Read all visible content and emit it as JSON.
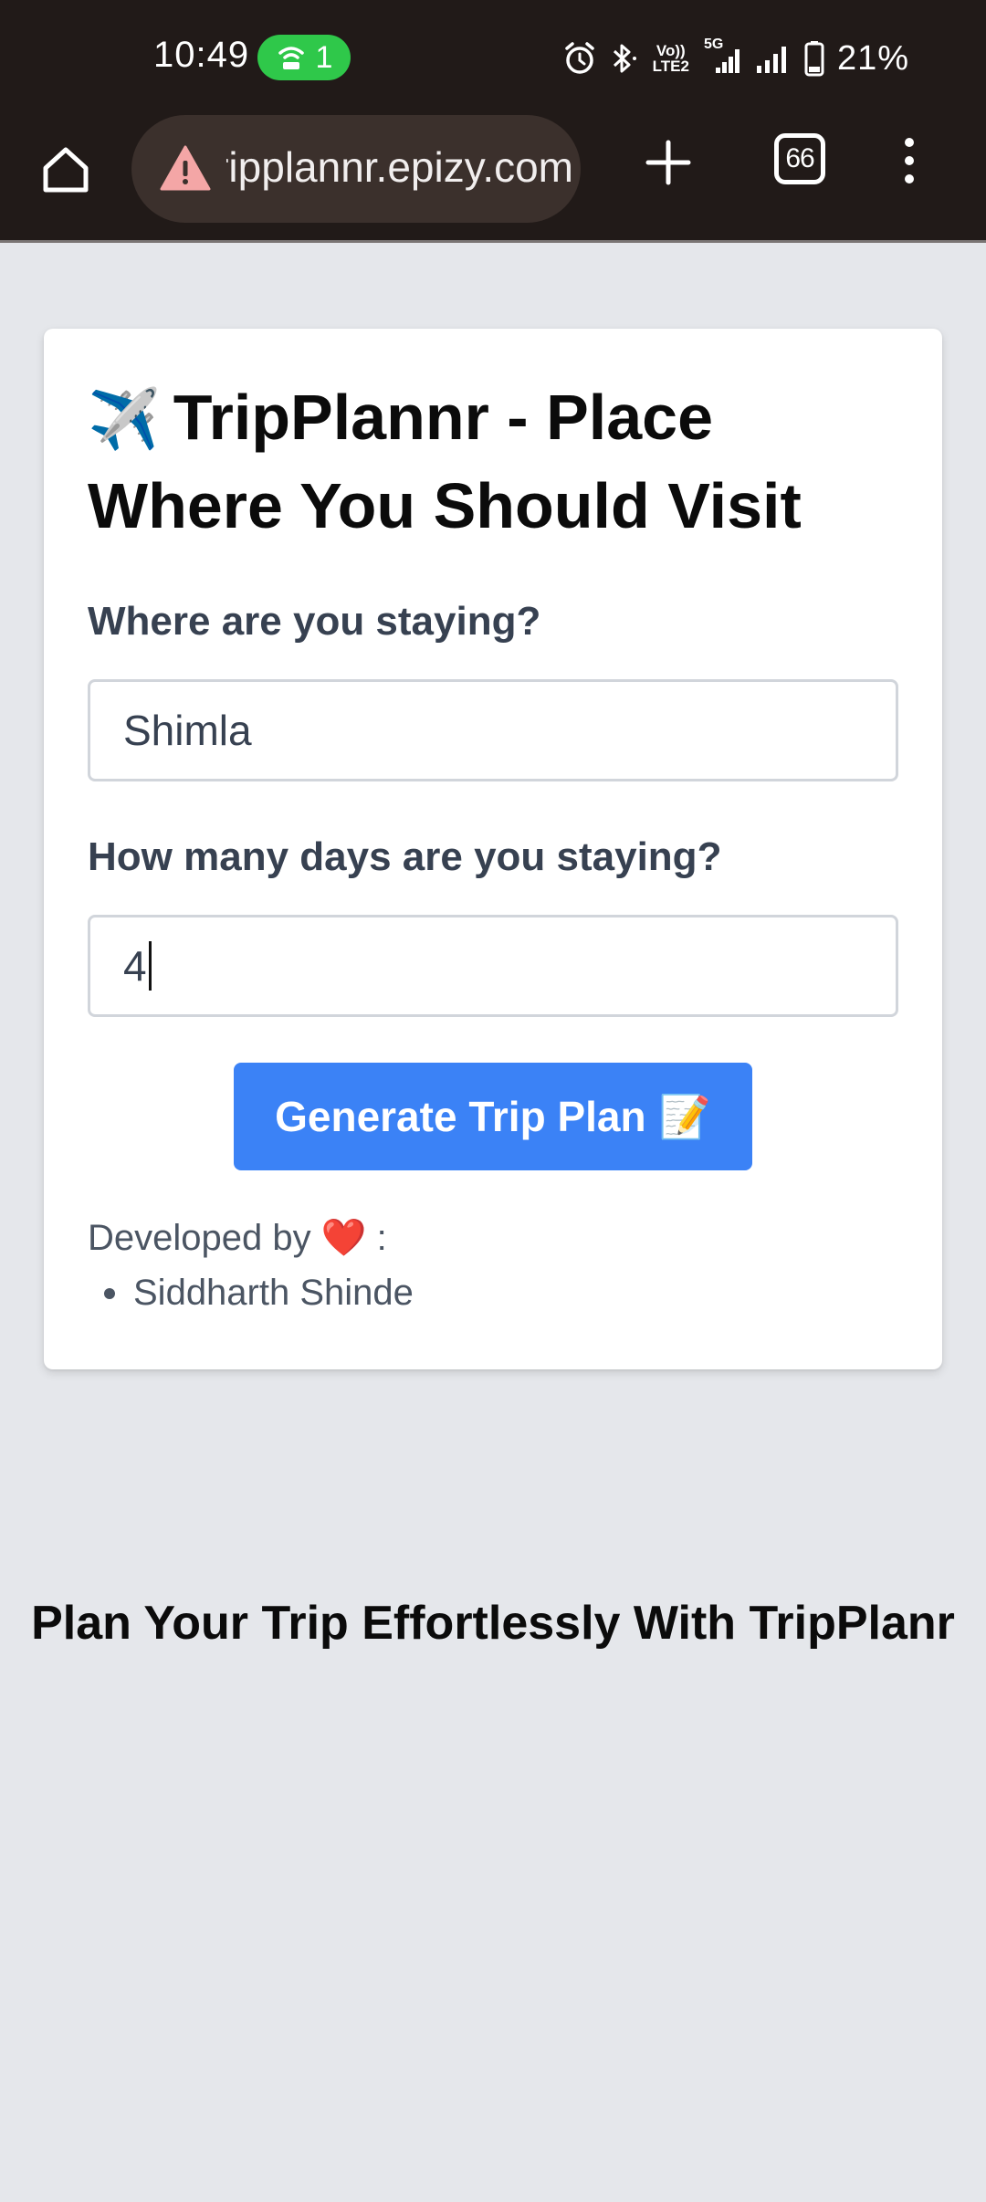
{
  "status_bar": {
    "time": "10:49",
    "hotspot_count": "1",
    "battery_pct": "21%",
    "volte_top": "Vo))",
    "volte_bottom": "LTE2",
    "network_type": "5G"
  },
  "browser": {
    "url": "tripplannr.epizy.com",
    "tab_count": "66",
    "security_status": "not-secure-warning"
  },
  "card": {
    "title_emoji": "✈️",
    "title": "TripPlannr - Place Where You Should Visit",
    "staying_label": "Where are you staying?",
    "staying_value": "Shimla",
    "days_label": "How many days are you staying?",
    "days_value": "4",
    "generate_label": "Generate Trip Plan",
    "generate_emoji": "📝",
    "developed_by": "Developed by",
    "developed_heart": "❤️",
    "developed_suffix": ":",
    "developers": [
      "Siddharth Shinde"
    ]
  },
  "footer": {
    "tagline": "Plan Your Trip Effortlessly With TripPlanr"
  },
  "colors": {
    "chrome_bg": "#211a18",
    "urlbar_bg": "#3b302c",
    "page_bg": "#e5e7eb",
    "button_bg": "#3b82f6",
    "hotspot_green": "#2fc84a",
    "warning_pink": "#f4a6a6"
  }
}
